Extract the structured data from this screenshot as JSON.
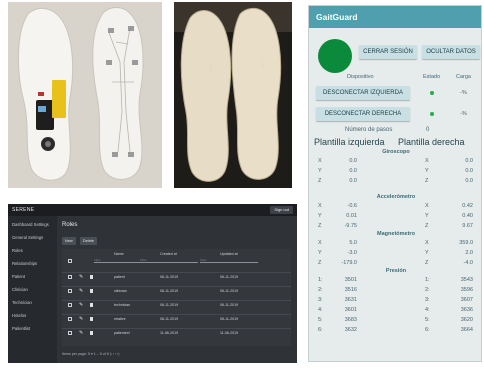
{
  "app": {
    "title": "GaitGuard",
    "buttons": {
      "close_session": "CERRAR SESIÓN",
      "hide_data": "OCULTAR DATOS",
      "disconnect_left": "DESCONECTAR IZQUIERDA",
      "disconnect_right": "DESCONECTAR DERECHA"
    },
    "headers": {
      "device": "Dispositivo",
      "status": "Estado",
      "charge": "Carga"
    },
    "charge_left": "-%",
    "charge_right": "-%",
    "step_count_label": "Número de pasos",
    "step_count_value": "0",
    "left_label": "Plantilla izquierda",
    "right_label": "Plantilla derecha",
    "gyroscope": {
      "title": "Giroscopo",
      "rows": [
        {
          "axis": "X",
          "left": "0.0",
          "axis_r": "X",
          "right": "0.0"
        },
        {
          "axis": "Y",
          "left": "0.0",
          "axis_r": "Y",
          "right": "0.0"
        },
        {
          "axis": "Z",
          "left": "0.0",
          "axis_r": "Z",
          "right": "0.0"
        }
      ]
    },
    "accelerometer": {
      "title": "Accelerómetro",
      "rows": [
        {
          "axis": "X",
          "left": "-0.6",
          "axis_r": "X",
          "right": "0.42"
        },
        {
          "axis": "Y",
          "left": "0.01",
          "axis_r": "Y",
          "right": "0.40"
        },
        {
          "axis": "Z",
          "left": "-9.75",
          "axis_r": "Z",
          "right": "9.67"
        }
      ]
    },
    "magnetometer": {
      "title": "Magnetómetro",
      "rows": [
        {
          "axis": "X",
          "left": "5.0",
          "axis_r": "X",
          "right": "359.0"
        },
        {
          "axis": "Y",
          "left": "-3.0",
          "axis_r": "Y",
          "right": "2.0"
        },
        {
          "axis": "Z",
          "left": "-179.0",
          "axis_r": "Z",
          "right": "-4.0"
        }
      ]
    },
    "pressure": {
      "title": "Presión",
      "rows": [
        {
          "axis": "1:",
          "left": "3501",
          "axis_r": "1:",
          "right": "3543"
        },
        {
          "axis": "2:",
          "left": "3516",
          "axis_r": "2:",
          "right": "3596"
        },
        {
          "axis": "3:",
          "left": "3631",
          "axis_r": "3:",
          "right": "3607"
        },
        {
          "axis": "4:",
          "left": "3601",
          "axis_r": "4:",
          "right": "3636"
        },
        {
          "axis": "5:",
          "left": "3683",
          "axis_r": "5:",
          "right": "3620"
        },
        {
          "axis": "6:",
          "left": "3632",
          "axis_r": "6:",
          "right": "3664"
        }
      ]
    }
  },
  "serene": {
    "brand": "SERENE",
    "sign_out": "Sign out",
    "sidebar": [
      "Dashboard Settings",
      "General Settings",
      "Roles",
      "Relationships",
      "Patient",
      "Clinician",
      "Technician",
      "Hotelos",
      "Patientlist"
    ],
    "page_title": "Roles",
    "new_button": "New",
    "delete_button": "Delete",
    "columns": [
      "Name",
      "Created at",
      "Updated at"
    ],
    "filter_placeholder": "Filter",
    "rows": [
      {
        "name": "patient",
        "created": "06-11-2019",
        "updated": "06-11-2019"
      },
      {
        "name": "clinician",
        "created": "06-11-2019",
        "updated": "06-11-2019"
      },
      {
        "name": "technician",
        "created": "06-11-2019",
        "updated": "06-11-2019"
      },
      {
        "name": "relative",
        "created": "06-11-2019",
        "updated": "06-11-2019"
      },
      {
        "name": "patientext",
        "created": "11-06-2019",
        "updated": "11-06-2019"
      }
    ],
    "pager": "Items per page: 5   ▾     1 – 5 of 8      |‹   ‹   ›   ›|"
  }
}
